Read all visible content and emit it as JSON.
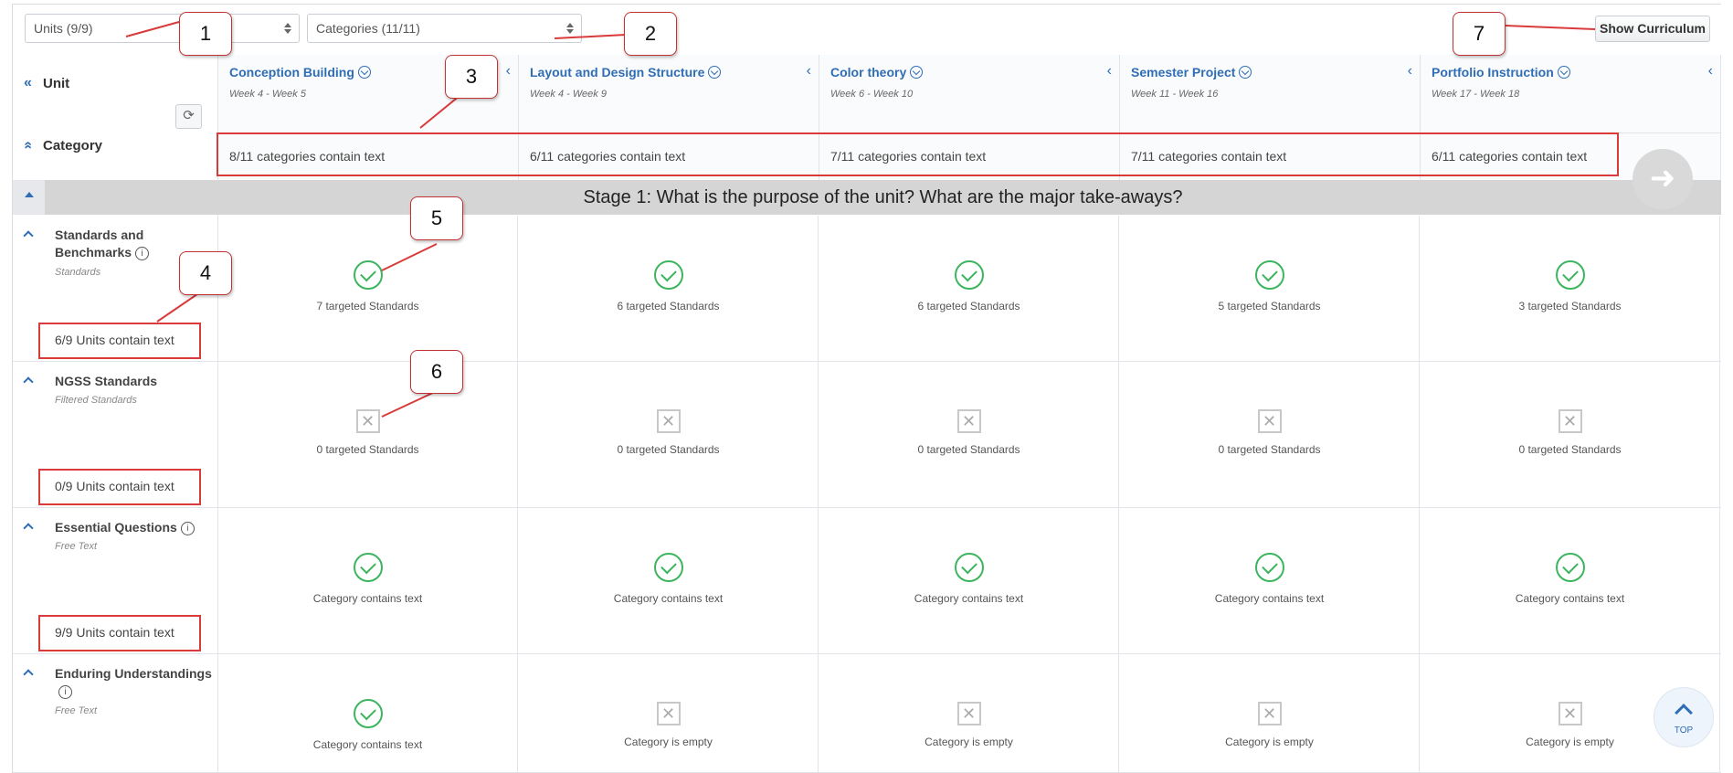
{
  "toolbar": {
    "units_select": "Units (9/9)",
    "categories_select": "Categories (11/11)",
    "show_curriculum": "Show Curriculum"
  },
  "left": {
    "unit_label": "Unit",
    "category_label": "Category"
  },
  "units": [
    {
      "title": "Conception Building",
      "weeks": "Week 4 - Week 5",
      "count": "8/11 categories contain text"
    },
    {
      "title": "Layout and Design Structure",
      "weeks": "Week 4 - Week 9",
      "count": "6/11 categories contain text"
    },
    {
      "title": "Color theory",
      "weeks": "Week 6 - Week 10",
      "count": "7/11 categories contain text"
    },
    {
      "title": "Semester Project",
      "weeks": "Week 11 - Week 16",
      "count": "7/11 categories contain text"
    },
    {
      "title": "Portfolio Instruction",
      "weeks": "Week 17 - Week 18",
      "count": "6/11 categories contain text"
    }
  ],
  "stage": "Stage 1: What is the purpose of the unit? What are the major take-aways?",
  "rows": [
    {
      "label": "Standards and Benchmarks",
      "sub": "Standards",
      "summary": "6/9 Units contain text",
      "cells": [
        {
          "status": "ok",
          "text": "7 targeted Standards"
        },
        {
          "status": "ok",
          "text": "6 targeted Standards"
        },
        {
          "status": "ok",
          "text": "6 targeted Standards"
        },
        {
          "status": "ok",
          "text": "5 targeted Standards"
        },
        {
          "status": "ok",
          "text": "3 targeted Standards"
        }
      ]
    },
    {
      "label": "NGSS Standards",
      "sub": "Filtered Standards",
      "summary": "0/9 Units contain text",
      "cells": [
        {
          "status": "empty",
          "text": "0 targeted Standards"
        },
        {
          "status": "empty",
          "text": "0 targeted Standards"
        },
        {
          "status": "empty",
          "text": "0 targeted Standards"
        },
        {
          "status": "empty",
          "text": "0 targeted Standards"
        },
        {
          "status": "empty",
          "text": "0 targeted Standards"
        }
      ]
    },
    {
      "label": "Essential Questions",
      "sub": "Free Text",
      "summary": "9/9 Units contain text",
      "cells": [
        {
          "status": "ok",
          "text": "Category contains text"
        },
        {
          "status": "ok",
          "text": "Category contains text"
        },
        {
          "status": "ok",
          "text": "Category contains text"
        },
        {
          "status": "ok",
          "text": "Category contains text"
        },
        {
          "status": "ok",
          "text": "Category contains text"
        }
      ]
    },
    {
      "label": "Enduring Understandings",
      "sub": "Free Text",
      "summary": "",
      "cells": [
        {
          "status": "ok",
          "text": "Category contains text"
        },
        {
          "status": "empty",
          "text": "Category is empty"
        },
        {
          "status": "empty",
          "text": "Category is empty"
        },
        {
          "status": "empty",
          "text": "Category is empty"
        },
        {
          "status": "empty",
          "text": "Category is empty"
        }
      ]
    }
  ],
  "callouts": [
    "1",
    "2",
    "3",
    "4",
    "5",
    "6",
    "7"
  ],
  "top_button": "TOP",
  "colors": {
    "accent": "#2f6db5",
    "ok": "#3cb55e",
    "annotation": "#d93b3b"
  }
}
